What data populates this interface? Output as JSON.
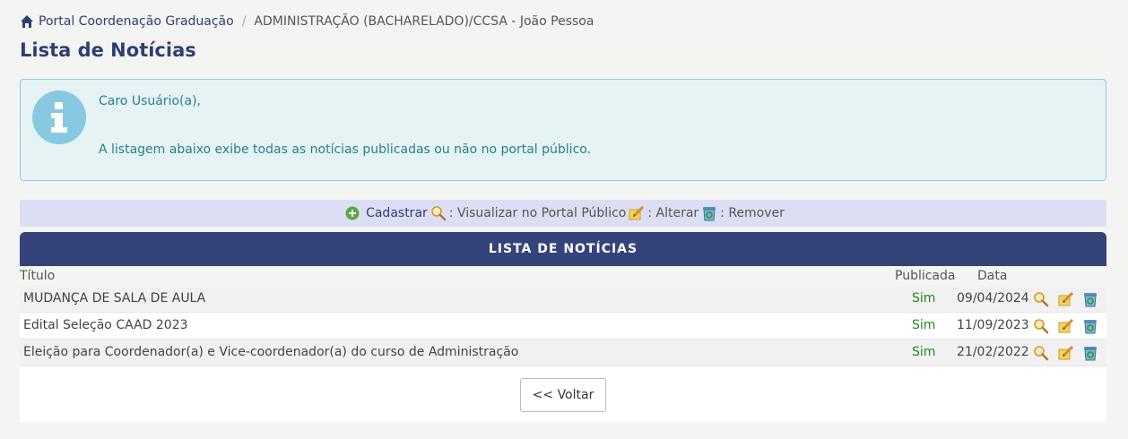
{
  "breadcrumb": {
    "home_label": "Portal Coordenação Graduação",
    "current": "ADMINISTRAÇÃO (BACHARELADO)/CCSA - João Pessoa"
  },
  "page_title": "Lista de Notícias",
  "info": {
    "greeting": "Caro Usuário(a),",
    "message": "A listagem abaixo exibe todas as notícias publicadas ou não no portal público."
  },
  "legend": {
    "cadastrar": "Cadastrar",
    "visualizar": ": Visualizar no Portal Público",
    "alterar": ": Alterar",
    "remover": ": Remover"
  },
  "table": {
    "header": "LISTA DE NOTÍCIAS",
    "columns": {
      "titulo": "Título",
      "publicada": "Publicada",
      "data": "Data"
    },
    "rows": [
      {
        "titulo": "MUDANÇA DE SALA DE AULA",
        "publicada": "Sim",
        "data": "09/04/2024"
      },
      {
        "titulo": "Edital Seleção CAAD 2023",
        "publicada": "Sim",
        "data": "11/09/2023"
      },
      {
        "titulo": "Eleição para Coordenador(a) e Vice-coordenador(a) do curso de Administração",
        "publicada": "Sim",
        "data": "21/02/2022"
      }
    ]
  },
  "voltar_label": "<< Voltar",
  "colors": {
    "primary": "#34437a",
    "info_bg": "#e5f3f5",
    "info_text": "#2b7f8a",
    "legend_bg": "#dcdff3",
    "published": "#1f8a1f"
  },
  "icons": {
    "home": "home-icon",
    "info": "info-icon",
    "add": "plus-circle-icon",
    "view": "magnifier-icon",
    "edit": "pencil-note-icon",
    "remove": "recycle-bin-icon"
  }
}
